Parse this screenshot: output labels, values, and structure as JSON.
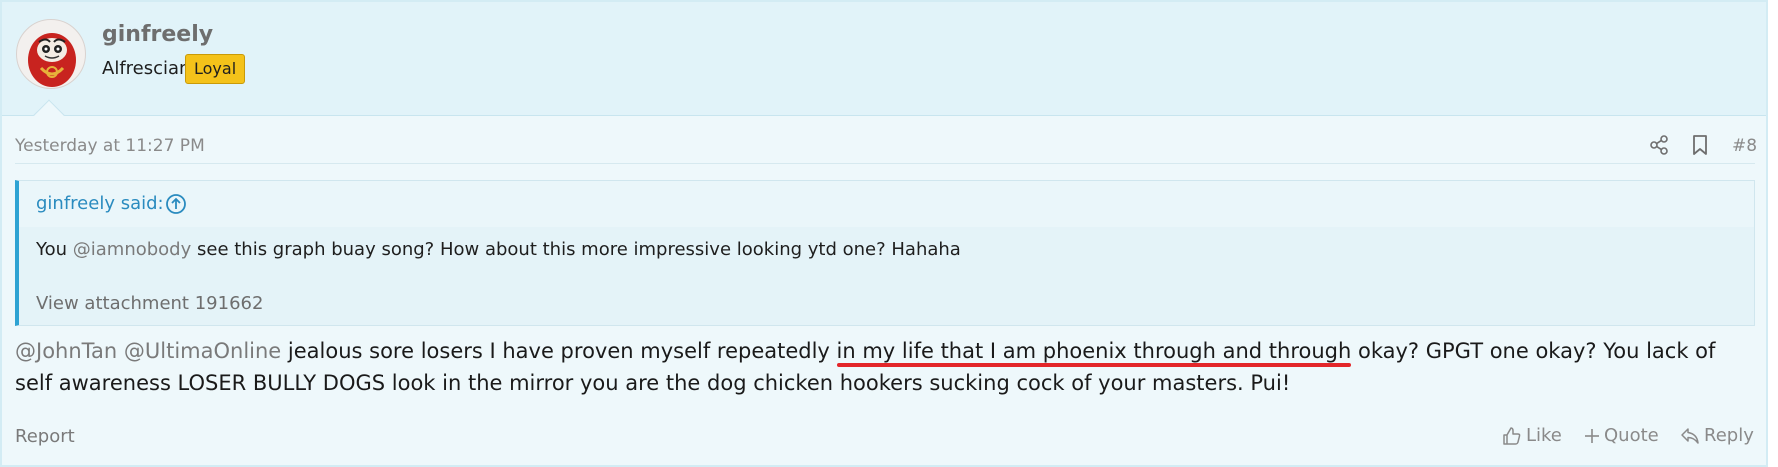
{
  "user": {
    "username": "ginfreely",
    "title": "Alfrescian",
    "badge": "Loyal",
    "avatar_icon": "daruma-doll-avatar"
  },
  "post": {
    "timestamp": "Yesterday at 11:27 PM",
    "number": "#8",
    "share_icon": "share-icon",
    "bookmark_icon": "bookmark-icon"
  },
  "quote": {
    "author": "ginfreely said:",
    "text_before": "You ",
    "mention": "@iamnobody",
    "text_after": " see this graph buay song? How about this more impressive looking ytd one? Hahaha",
    "attachment": "View attachment 191662"
  },
  "body": {
    "mention1": "@JohnTan",
    "mention2": "@UltimaOnline",
    "text1": " jealous sore losers I have proven myself repeatedly ",
    "underlined": "in my life that I am phoenix through and through",
    "text2": " okay? GPGT one okay? You lack of self awareness LOSER BULLY DOGS look in the mirror you are the dog chicken hookers sucking cock of your masters. Pui!",
    "underline_color": "#e3262a"
  },
  "footer": {
    "report": "Report",
    "like": "Like",
    "quote": "Quote",
    "reply": "Reply"
  },
  "colors": {
    "accent": "#2ea3d3",
    "badge": "#f4c21a"
  }
}
